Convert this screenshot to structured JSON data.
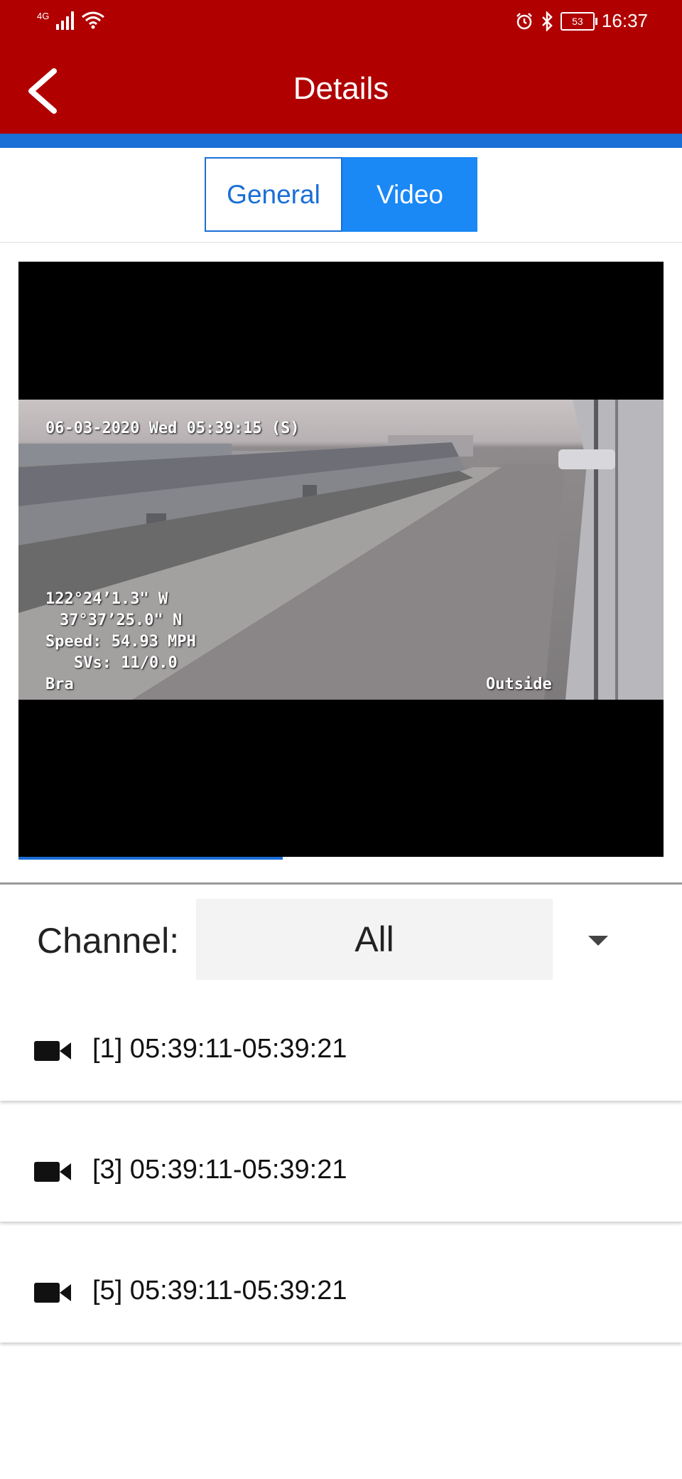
{
  "status_bar": {
    "network": "4G",
    "time": "16:37",
    "battery": "53"
  },
  "header": {
    "title": "Details"
  },
  "tabs": [
    {
      "label": "General",
      "active": false
    },
    {
      "label": "Video",
      "active": true
    }
  ],
  "video": {
    "overlay": {
      "datetime": "06-03-2020 Wed 05:39:15 (S)",
      "longitude": "122°24’1.3\" W",
      "latitude": "37°37’25.0\" N",
      "speed": "Speed: 54.93 MPH",
      "svs": "SVs: 11/0.0",
      "label_left": "Bra",
      "label_right": "Outside"
    },
    "progress": 0.41
  },
  "channel": {
    "label": "Channel:",
    "value": "All"
  },
  "clips": [
    {
      "text": "[1] 05:39:11-05:39:21"
    },
    {
      "text": "[3] 05:39:11-05:39:21"
    },
    {
      "text": "[5] 05:39:11-05:39:21"
    }
  ],
  "colors": {
    "header_red": "#b00000",
    "accent_blue": "#1a6fd6",
    "tab_active_blue": "#1a88f5"
  }
}
